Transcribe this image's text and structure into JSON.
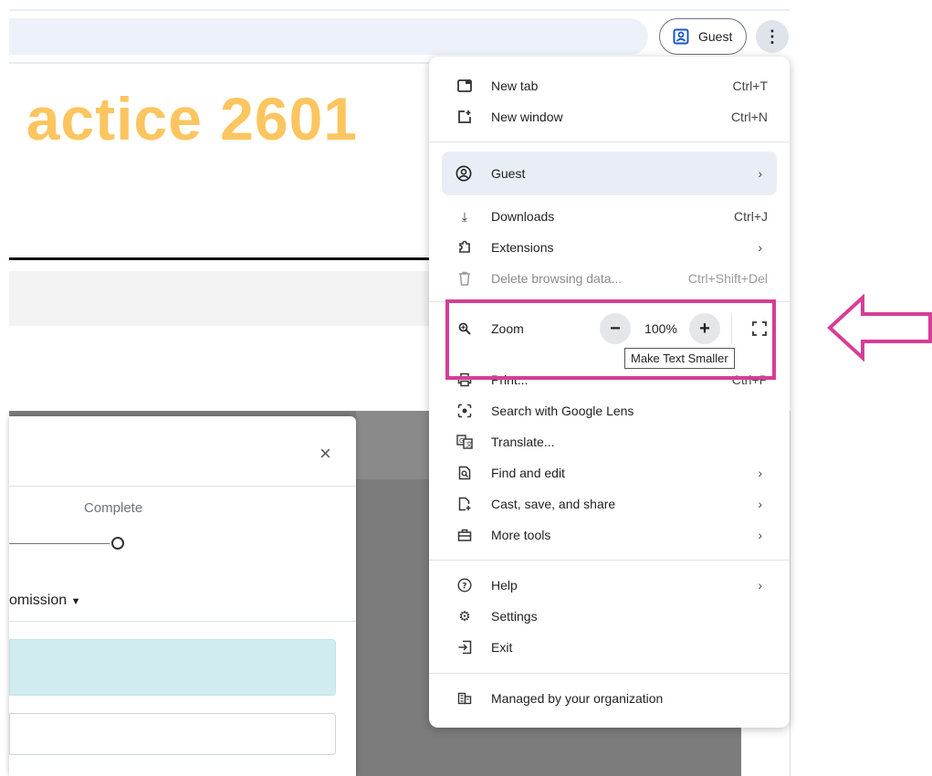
{
  "browser": {
    "profile_chip_label": "Guest"
  },
  "page": {
    "heading": "actice 2601"
  },
  "modal": {
    "close_glyph": "×",
    "step_label": "Complete",
    "dropdown_text": "omission"
  },
  "menu": {
    "items_top": [
      {
        "icon": "new-tab-icon",
        "label": "New tab",
        "shortcut": "Ctrl+T"
      },
      {
        "icon": "new-window-icon",
        "label": "New window",
        "shortcut": "Ctrl+N"
      }
    ],
    "guest": {
      "icon": "account-circle-icon",
      "label": "Guest"
    },
    "items_mid": [
      {
        "icon": "download-icon",
        "label": "Downloads",
        "shortcut": "Ctrl+J"
      },
      {
        "icon": "extension-icon",
        "label": "Extensions",
        "shortcut": ""
      },
      {
        "icon": "trash-icon",
        "label": "Delete browsing data...",
        "shortcut": "Ctrl+Shift+Del"
      }
    ],
    "zoom": {
      "icon": "zoom-icon",
      "label": "Zoom",
      "value": "100%",
      "minus": "−",
      "plus": "+"
    },
    "tooltip": "Make Text Smaller",
    "print": {
      "icon": "print-icon",
      "label": "Print...",
      "shortcut": "Ctrl+P"
    },
    "items_tools": [
      {
        "icon": "lens-icon",
        "label": "Search with Google Lens"
      },
      {
        "icon": "translate-icon",
        "label": "Translate..."
      },
      {
        "icon": "find-icon",
        "label": "Find and edit"
      },
      {
        "icon": "cast-icon",
        "label": "Cast, save, and share"
      },
      {
        "icon": "toolbox-icon",
        "label": "More tools"
      }
    ],
    "items_bottom": [
      {
        "icon": "help-icon",
        "label": "Help"
      },
      {
        "icon": "settings-icon",
        "label": "Settings"
      },
      {
        "icon": "exit-icon",
        "label": "Exit"
      }
    ],
    "managed": {
      "icon": "building-icon",
      "label": "Managed by your organization"
    }
  },
  "colors": {
    "highlight": "#d63d96",
    "heading": "#fcc55f"
  }
}
